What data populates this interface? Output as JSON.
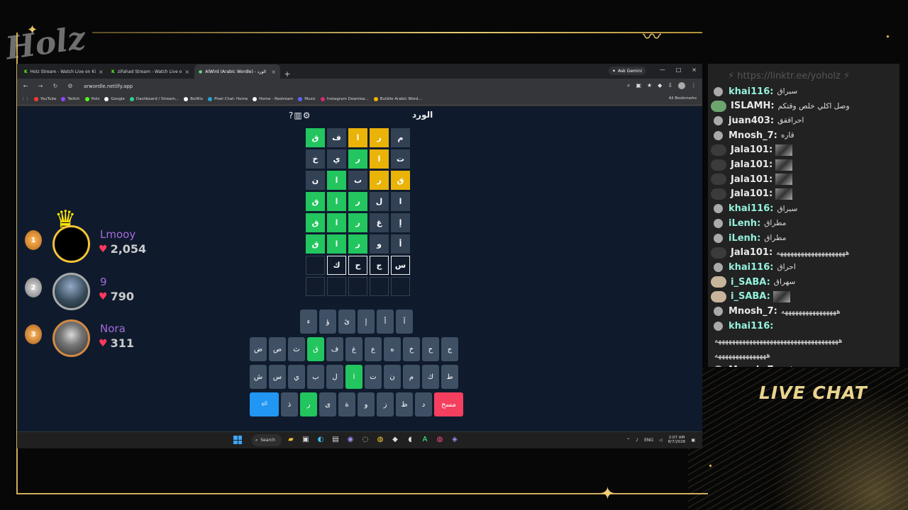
{
  "browser": {
    "tabs": [
      {
        "title": "Holz Stream - Watch Live on Ki",
        "icon": "twitch-icon"
      },
      {
        "title": "ziFahad Stream - Watch Live o",
        "icon": "twitch-icon"
      },
      {
        "title": "AlWird (Arabic Wordle) - الورد",
        "icon": "game-icon"
      }
    ],
    "new_tab": "+",
    "ask_gemini": "Ask Gemini",
    "url": "arwordle.netlify.app",
    "bookmarks": [
      "YouTube",
      "Twitch",
      "Holz",
      "Google",
      "Dashboard / Stream...",
      "BotRix",
      "Pixel Chat: Home",
      "Home - Restream",
      "Music",
      "Instagram Downloa...",
      "Buildle Arabic Word..."
    ],
    "all_bookmarks": "All Bookmarks"
  },
  "game": {
    "title": "الورد",
    "tools": [
      "?",
      "▥",
      "⚙"
    ],
    "rows": [
      [
        {
          "l": "ق",
          "s": "g"
        },
        {
          "l": "ف",
          "s": "x"
        },
        {
          "l": "ا",
          "s": "y"
        },
        {
          "l": "ر",
          "s": "y"
        },
        {
          "l": "م",
          "s": "x"
        }
      ],
      [
        {
          "l": "خ",
          "s": "x"
        },
        {
          "l": "ي",
          "s": "x"
        },
        {
          "l": "ر",
          "s": "g"
        },
        {
          "l": "ا",
          "s": "y"
        },
        {
          "l": "ت",
          "s": "x"
        }
      ],
      [
        {
          "l": "ن",
          "s": "x"
        },
        {
          "l": "ا",
          "s": "g"
        },
        {
          "l": "ب",
          "s": "x"
        },
        {
          "l": "ر",
          "s": "y"
        },
        {
          "l": "ق",
          "s": "y"
        }
      ],
      [
        {
          "l": "ق",
          "s": "g"
        },
        {
          "l": "ا",
          "s": "g"
        },
        {
          "l": "ر",
          "s": "g"
        },
        {
          "l": "ل",
          "s": "x"
        },
        {
          "l": "ا",
          "s": "x"
        }
      ],
      [
        {
          "l": "ق",
          "s": "g"
        },
        {
          "l": "ا",
          "s": "g"
        },
        {
          "l": "ر",
          "s": "g"
        },
        {
          "l": "غ",
          "s": "x"
        },
        {
          "l": "إ",
          "s": "x"
        }
      ],
      [
        {
          "l": "ق",
          "s": "g"
        },
        {
          "l": "ا",
          "s": "g"
        },
        {
          "l": "ر",
          "s": "g"
        },
        {
          "l": "و",
          "s": "x"
        },
        {
          "l": "أ",
          "s": "x"
        }
      ],
      [
        {
          "l": "",
          "s": "e"
        },
        {
          "l": "ك",
          "s": "t"
        },
        {
          "l": "ح",
          "s": "t"
        },
        {
          "l": "ج",
          "s": "t"
        },
        {
          "l": "س",
          "s": "t"
        }
      ],
      [
        {
          "l": "",
          "s": "e"
        },
        {
          "l": "",
          "s": "e"
        },
        {
          "l": "",
          "s": "e"
        },
        {
          "l": "",
          "s": "e"
        },
        {
          "l": "",
          "s": "e"
        }
      ]
    ],
    "keyboard": {
      "row1": [
        "ء",
        "ؤ",
        "ئ",
        "إ",
        "أ",
        "آ"
      ],
      "row2": [
        "ض",
        "ص",
        "ث",
        "ق",
        "ف",
        "غ",
        "ع",
        "ه",
        "خ",
        "ح",
        "ج"
      ],
      "row2_states": [
        "x",
        "x",
        "x",
        "g",
        "x",
        "x",
        "x",
        "x",
        "x",
        "x",
        "x"
      ],
      "row3": [
        "ش",
        "س",
        "ي",
        "ب",
        "ل",
        "ا",
        "ت",
        "ن",
        "م",
        "ك",
        "ط"
      ],
      "row3_states": [
        "x",
        "x",
        "x",
        "x",
        "x",
        "g",
        "x",
        "x",
        "x",
        "x",
        "x"
      ],
      "row4": [
        "⏎",
        "ذ",
        "ر",
        "ى",
        "ة",
        "و",
        "ز",
        "ظ",
        "د",
        "مسح"
      ],
      "row4_states": [
        "enter",
        "x",
        "g",
        "x",
        "x",
        "x",
        "x",
        "x",
        "x",
        "del"
      ]
    }
  },
  "taskbar": {
    "search": "Search",
    "language": "ENG",
    "time": "2:07 AM",
    "date": "8/7/2026"
  },
  "leaderboard": [
    {
      "rank": "1",
      "name": "Lmooy",
      "score": "2,054",
      "name_color": "#a56bd8"
    },
    {
      "rank": "2",
      "name": "9",
      "score": "790",
      "name_color": "#a56bd8"
    },
    {
      "rank": "3",
      "name": "Nora",
      "score": "311",
      "name_color": "#a56bd8"
    }
  ],
  "chat": {
    "link": "⚡ https://linktr.ee/yoholz ⚡",
    "messages": [
      {
        "user": "khai116:",
        "text": "سبراق",
        "avatar": "person",
        "user_color": "#94f0dc"
      },
      {
        "user": "ISLAMH:",
        "text": "وصل اكلي خلص وقتكم",
        "avatar": "green",
        "user_color": "#e8e8e8"
      },
      {
        "user": "juan403:",
        "text": "احراققق",
        "avatar": "person",
        "user_color": "#e8e8e8"
      },
      {
        "user": "Mnosh_7:",
        "text": "قاره",
        "avatar": "person",
        "user_color": "#e8e8e8"
      },
      {
        "user": "Jala101:",
        "text": "",
        "avatar": "photo",
        "user_color": "#e8e8e8",
        "emote": true
      },
      {
        "user": "Jala101:",
        "text": "",
        "avatar": "photo",
        "user_color": "#e8e8e8",
        "emote": true
      },
      {
        "user": "Jala101:",
        "text": "",
        "avatar": "photo",
        "user_color": "#e8e8e8",
        "emote": true
      },
      {
        "user": "Jala101:",
        "text": "",
        "avatar": "photo",
        "user_color": "#e8e8e8",
        "emote": true
      },
      {
        "user": "khai116:",
        "text": "سبراق",
        "avatar": "person",
        "user_color": "#94f0dc"
      },
      {
        "user": "iLenh:",
        "text": "مطراق",
        "avatar": "person",
        "user_color": "#94f0dc"
      },
      {
        "user": "iLenh:",
        "text": "مطراق",
        "avatar": "person",
        "user_color": "#94f0dc"
      },
      {
        "user": "Jala101:",
        "text": "ههههههههههههههههههههه",
        "avatar": "photo",
        "user_color": "#e8e8e8"
      },
      {
        "user": "khai116:",
        "text": "احراق",
        "avatar": "person",
        "user_color": "#94f0dc"
      },
      {
        "user": "i_SABA:",
        "text": "سهراق",
        "avatar": "face",
        "user_color": "#94f0dc"
      },
      {
        "user": "i_SABA:",
        "text": "",
        "avatar": "face",
        "user_color": "#94f0dc",
        "emote": true
      },
      {
        "user": "Mnosh_7:",
        "text": "ههههههههههههههههه",
        "avatar": "person",
        "user_color": "#e8e8e8"
      },
      {
        "user": "khai116:",
        "text": "",
        "avatar": "person",
        "user_color": "#94f0dc"
      },
      {
        "user": "",
        "text": "ههههههههههههههههههههههههههههههههههههه",
        "avatar": "none",
        "user_color": "#e8e8e8"
      },
      {
        "user": "",
        "text": "هههههههههههههههه",
        "avatar": "none",
        "user_color": "#e8e8e8"
      },
      {
        "user": "Mnosh_7:",
        "text": "عصر زراديه",
        "avatar": "person",
        "user_color": "#e8e8e8"
      }
    ]
  },
  "overlay": {
    "logo": "Holz",
    "live_chat": "LIVE CHAT"
  }
}
